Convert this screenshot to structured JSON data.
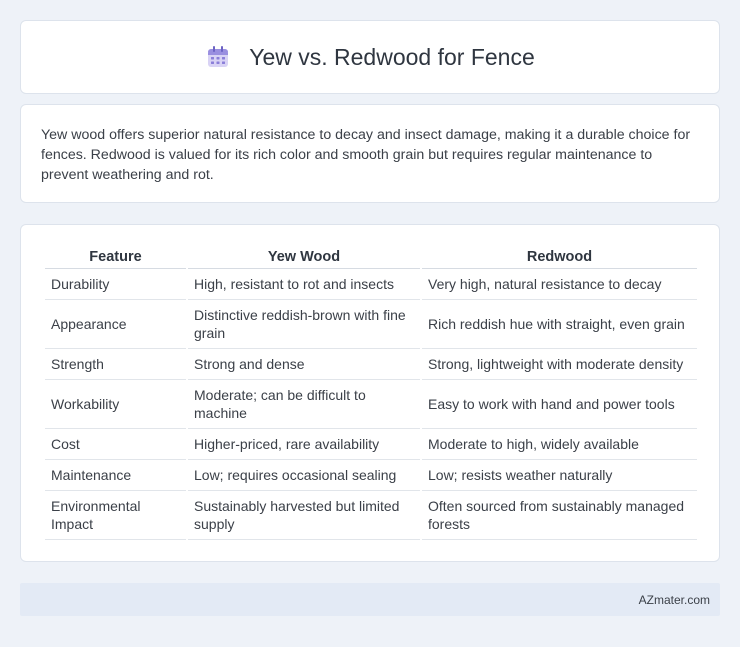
{
  "header": {
    "title": "Yew vs. Redwood for Fence",
    "icon": "calendar-icon",
    "icon_color": "#8b7fd9"
  },
  "intro": {
    "text": "Yew wood offers superior natural resistance to decay and insect damage, making it a durable choice for fences. Redwood is valued for its rich color and smooth grain but requires regular maintenance to prevent weathering and rot."
  },
  "table": {
    "headers": [
      "Feature",
      "Yew Wood",
      "Redwood"
    ],
    "rows": [
      [
        "Durability",
        "High, resistant to rot and insects",
        "Very high, natural resistance to decay"
      ],
      [
        "Appearance",
        "Distinctive reddish-brown with fine grain",
        "Rich reddish hue with straight, even grain"
      ],
      [
        "Strength",
        "Strong and dense",
        "Strong, lightweight with moderate density"
      ],
      [
        "Workability",
        "Moderate; can be difficult to machine",
        "Easy to work with hand and power tools"
      ],
      [
        "Cost",
        "Higher-priced, rare availability",
        "Moderate to high, widely available"
      ],
      [
        "Maintenance",
        "Low; requires occasional sealing",
        "Low; resists weather naturally"
      ],
      [
        "Environmental Impact",
        "Sustainably harvested but limited supply",
        "Often sourced from sustainably managed forests"
      ]
    ]
  },
  "footer": {
    "text": "AZmater.com"
  }
}
